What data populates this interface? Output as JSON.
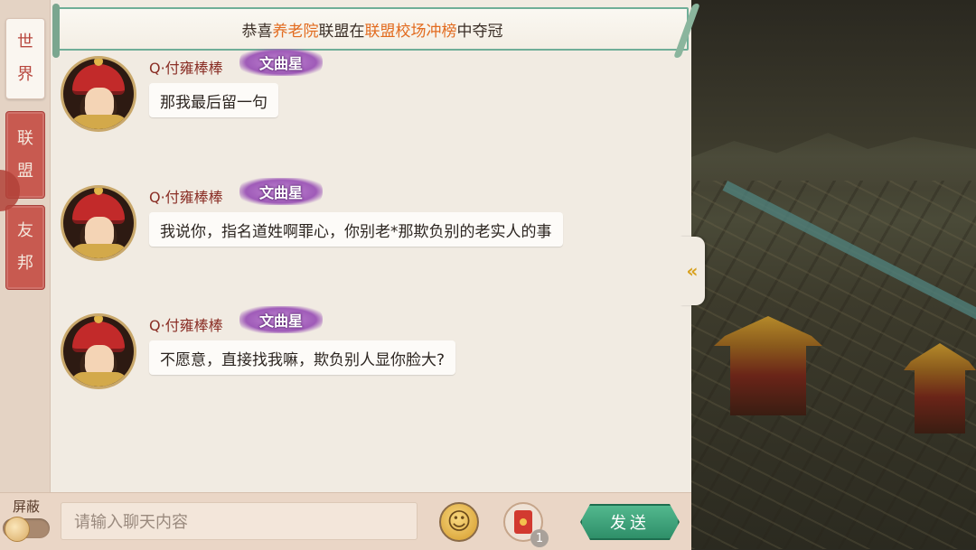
{
  "tabs": [
    {
      "label": "世界",
      "chars": [
        "世",
        "界"
      ],
      "active": true
    },
    {
      "label": "联盟",
      "chars": [
        "联",
        "盟"
      ],
      "active": false
    },
    {
      "label": "友邦",
      "chars": [
        "友",
        "邦"
      ],
      "active": false
    }
  ],
  "banner": {
    "prefix": "恭喜",
    "alliance": "养老院",
    "mid": "联盟在",
    "event": "联盟校场冲榜",
    "suffix": "中夺冠"
  },
  "messages": [
    {
      "name": "Q·付雍棒棒",
      "title": "文曲星",
      "text": "那我最后留一句"
    },
    {
      "name": "Q·付雍棒棒",
      "title": "文曲星",
      "text": "我说你，指名道姓啊罪心，你别老*那欺负别的老实人的事"
    },
    {
      "name": "Q·付雍棒棒",
      "title": "文曲星",
      "text": "不愿意，直接找我嘛，欺负别人显你脸大?"
    }
  ],
  "bottom": {
    "block_label": "屏蔽",
    "input_placeholder": "请输入聊天内容",
    "emoji_icon": "☺",
    "redpacket_count": "1",
    "send_label": "发送"
  },
  "side_arrow": "«",
  "colors": {
    "accent_orange": "#e26b1f",
    "tab_red": "#c85a50",
    "send_green": "#2f8f69"
  }
}
